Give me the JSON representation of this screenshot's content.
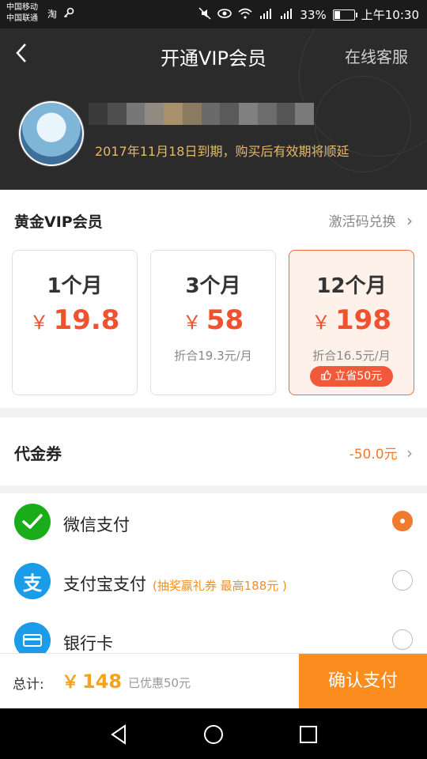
{
  "status_bar": {
    "carrier_1": "中国移动",
    "carrier_2": "中国联通",
    "app_icon_1": "淘",
    "battery": "33%",
    "time": "上午10:30"
  },
  "header": {
    "title": "开通VIP会员",
    "service_link": "在线客服",
    "expire_text": "2017年11月18日到期，购买后有效期将顺延"
  },
  "membership": {
    "title": "黄金VIP会员",
    "redeem_label": "激活码兑换",
    "currency": "￥",
    "plans": [
      {
        "duration": "1个月",
        "price": "19.8",
        "per_month": ""
      },
      {
        "duration": "3个月",
        "price": "58",
        "per_month": "折合19.3元/月"
      },
      {
        "duration": "12个月",
        "price": "198",
        "per_month": "折合16.5元/月",
        "badge": "立省50元"
      }
    ],
    "selected_plan": 2
  },
  "coupon": {
    "label": "代金券",
    "amount": "-50.0元"
  },
  "payment": {
    "methods": [
      {
        "name": "微信支付",
        "note": "",
        "selected": true,
        "icon": "wechat-pay-icon",
        "color": "#1aad19"
      },
      {
        "name": "支付宝支付",
        "note": "(抽奖赢礼券 最高188元 )",
        "selected": false,
        "icon": "alipay-icon",
        "color": "#1a9ce8"
      },
      {
        "name": "银行卡",
        "note": "",
        "selected": false,
        "icon": "bank-card-icon",
        "color": "#1a9ce8"
      }
    ]
  },
  "footer": {
    "total_label": "总计:",
    "currency": "￥",
    "total_amount": "148",
    "discount_text": "已优惠50元",
    "confirm_label": "确认支付"
  },
  "colors": {
    "accent": "#f07b2f",
    "confirm": "#fb8c1e",
    "header_bg": "#2b2b2b",
    "expire": "#e6b86b"
  }
}
